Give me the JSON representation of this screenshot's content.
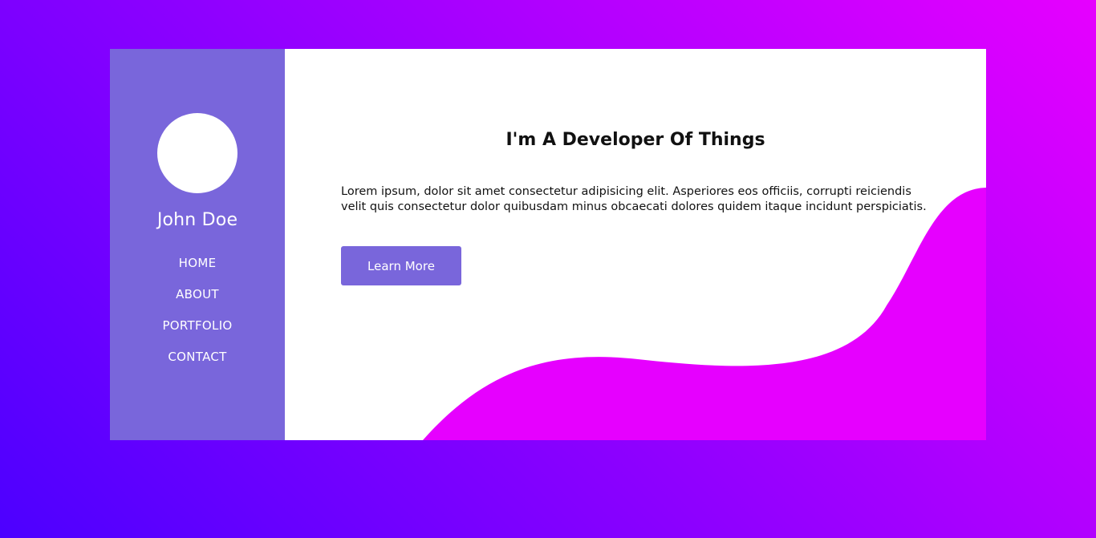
{
  "theme": {
    "background_gradient": [
      "#4c00ff",
      "#8f00ff",
      "#e600ff"
    ],
    "sidebar_color": "#7966db",
    "wave_color": "#e600ff",
    "button_color": "#7966db"
  },
  "profile": {
    "name": "John Doe"
  },
  "nav": {
    "items": [
      {
        "label": "HOME"
      },
      {
        "label": "ABOUT"
      },
      {
        "label": "PORTFOLIO"
      },
      {
        "label": "CONTACT"
      }
    ]
  },
  "hero": {
    "headline": "I'm A Developer Of Things",
    "paragraph": "Lorem ipsum, dolor sit amet consectetur adipisicing elit. Asperiores eos officiis, corrupti reiciendis velit quis consectetur dolor quibusdam minus obcaecati dolores quidem itaque incidunt perspiciatis.",
    "button_label": "Learn More"
  }
}
